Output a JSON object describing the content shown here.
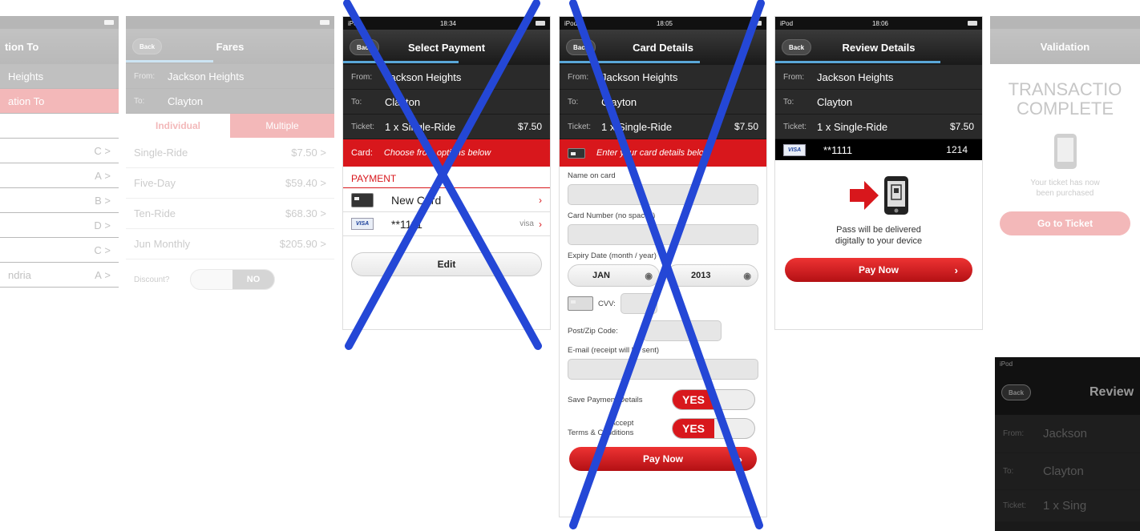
{
  "screen1": {
    "title": "tion To",
    "rows": [
      "Heights",
      "ation To",
      "",
      "",
      "",
      "",
      "",
      "",
      "ndria"
    ],
    "route_letters": [
      "C",
      "A",
      "B",
      "D",
      "C",
      "A"
    ]
  },
  "screen2": {
    "back": "Back",
    "title": "Fares",
    "from_label": "From:",
    "from_value": "Jackson Heights",
    "to_label": "To:",
    "to_value": "Clayton",
    "tabs": [
      "Individual",
      "Multiple"
    ],
    "fares": [
      {
        "name": "Single-Ride",
        "price": "$7.50"
      },
      {
        "name": "Five-Day",
        "price": "$59.40"
      },
      {
        "name": "Ten-Ride",
        "price": "$68.30"
      },
      {
        "name": "Jun Monthly",
        "price": "$205.90"
      }
    ],
    "discount_label": "Discount?",
    "discount_value": "NO"
  },
  "screen3": {
    "status_left": "iPod",
    "status_time": "18:34",
    "back": "Back",
    "title": "Select Payment",
    "from_label": "From:",
    "from_value": "Jackson Heights",
    "to_label": "To:",
    "to_value": "Clayton",
    "ticket_label": "Ticket:",
    "ticket_value": "1 x Single-Ride",
    "ticket_amount": "$7.50",
    "card_label": "Card:",
    "card_prompt": "Choose from options below",
    "section_header": "PAYMENT",
    "new_card": "New Card",
    "saved_card": "**1111",
    "saved_card_type": "visa",
    "edit_label": "Edit"
  },
  "screen4": {
    "status_left": "iPod",
    "status_time": "18:05",
    "back": "Back",
    "title": "Card Details",
    "from_label": "From:",
    "from_value": "Jackson Heights",
    "to_label": "To:",
    "to_value": "Clayton",
    "ticket_label": "Ticket:",
    "ticket_value": "1 x Single-Ride",
    "ticket_amount": "$7.50",
    "card_prompt": "Enter your card details below",
    "name_label": "Name on card",
    "number_label": "Card Number (no spaces)",
    "expiry_label": "Expiry Date (month / year)",
    "month": "JAN",
    "year": "2013",
    "cvv_label": "CVV:",
    "postcode_label": "Post/Zip Code:",
    "email_label": "E-mail (receipt will be sent)",
    "save_label": "Save Payment Details",
    "save_value": "YES",
    "accept_label_1": "Accept",
    "accept_label_2": "Terms & Conditions",
    "accept_value": "YES",
    "pay_now": "Pay Now"
  },
  "screen5": {
    "status_left": "iPod",
    "status_time": "18:06",
    "back": "Back",
    "title": "Review Details",
    "from_label": "From:",
    "from_value": "Jackson Heights",
    "to_label": "To:",
    "to_value": "Clayton",
    "ticket_label": "Ticket:",
    "ticket_value": "1 x Single-Ride",
    "ticket_amount": "$7.50",
    "card_number": "**1111",
    "card_expiry": "1214",
    "delivery_text_1": "Pass will be delivered",
    "delivery_text_2": "digitally to your device",
    "pay_now": "Pay Now"
  },
  "screen6": {
    "title": "Validation",
    "heading_1": "TRANSACTIO",
    "heading_2": "COMPLETE",
    "message_1": "Your ticket has now",
    "message_2": "been purchased",
    "button": "Go to Ticket"
  },
  "screen7": {
    "status_left": "iPod",
    "back": "Back",
    "title": "Review",
    "from_label": "From:",
    "from_value": "Jackson",
    "to_label": "To:",
    "to_value": "Clayton",
    "ticket_label": "Ticket:",
    "ticket_value": "1 x Sing"
  },
  "colors": {
    "accent_red": "#d8171c",
    "cross_blue": "#2447d6",
    "nav_dark": "#1a1a1a",
    "progress_blue": "#5aa7d8"
  }
}
